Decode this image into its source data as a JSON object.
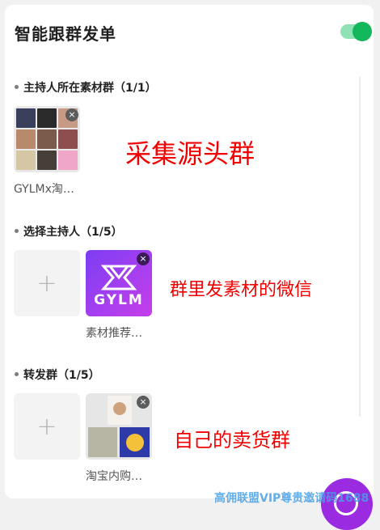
{
  "header": {
    "title": "智能跟群发单"
  },
  "sections": {
    "source_group": {
      "title": "主持人所在素材群（1/1）",
      "item_caption": "GYLMx淘…"
    },
    "host": {
      "title": "选择主持人（1/5）",
      "item_caption": "素材推荐…",
      "logo_text": "GYLM"
    },
    "forward": {
      "title": "转发群（1/5）",
      "item_caption": "淘宝内购…"
    }
  },
  "annotations": {
    "source": "采集源头群",
    "host": "群里发素材的微信",
    "forward": "自己的卖货群"
  },
  "icons": {
    "add": "+",
    "remove": "×"
  },
  "watermark": "高佣联盟VIP尊贵邀请码1688",
  "colors": {
    "toggle_on": "#11b75a",
    "annotation": "#f20000",
    "logo_gradient": "#8b3ef1"
  }
}
